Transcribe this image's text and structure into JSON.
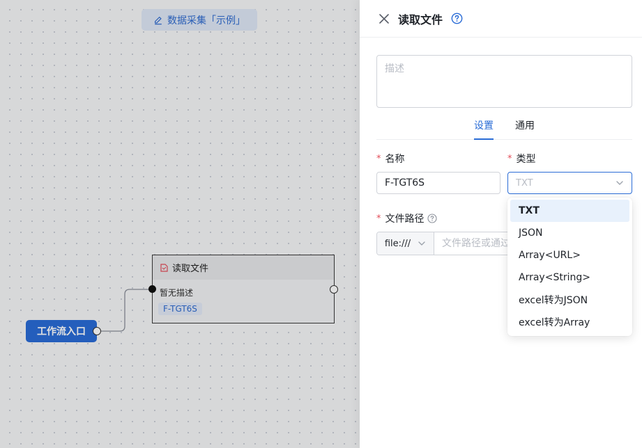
{
  "canvas": {
    "flow_title": "数据采集「示例」",
    "entry_node": {
      "label": "工作流入口"
    },
    "file_node": {
      "title": "读取文件",
      "description": "暂无描述",
      "tag": "F-TGT6S"
    }
  },
  "drawer": {
    "title": "读取文件",
    "description_placeholder": "描述",
    "tabs": [
      {
        "label": "设置",
        "active": true
      },
      {
        "label": "通用",
        "active": false
      }
    ],
    "name_field": {
      "label": "名称",
      "value": "F-TGT6S",
      "required": true
    },
    "type_field": {
      "label": "类型",
      "placeholder": "TXT",
      "required": true
    },
    "path_field": {
      "label": "文件路径",
      "prefix": "file:///",
      "placeholder": "文件路径或通过",
      "required": true
    },
    "type_options": [
      {
        "label": "TXT",
        "selected": true
      },
      {
        "label": "JSON",
        "selected": false
      },
      {
        "label": "Array<URL>",
        "selected": false
      },
      {
        "label": "Array<String>",
        "selected": false
      },
      {
        "label": "excel转为JSON",
        "selected": false
      },
      {
        "label": "excel转为Array",
        "selected": false
      }
    ]
  },
  "colors": {
    "accent": "#2a6cd6",
    "required_mark": "#e34d59",
    "selected_option_bg": "#e8f1fc"
  },
  "icons": [
    "pen-icon",
    "document-icon",
    "close-icon",
    "help-circle-icon",
    "question-icon",
    "chevron-down-icon"
  ]
}
